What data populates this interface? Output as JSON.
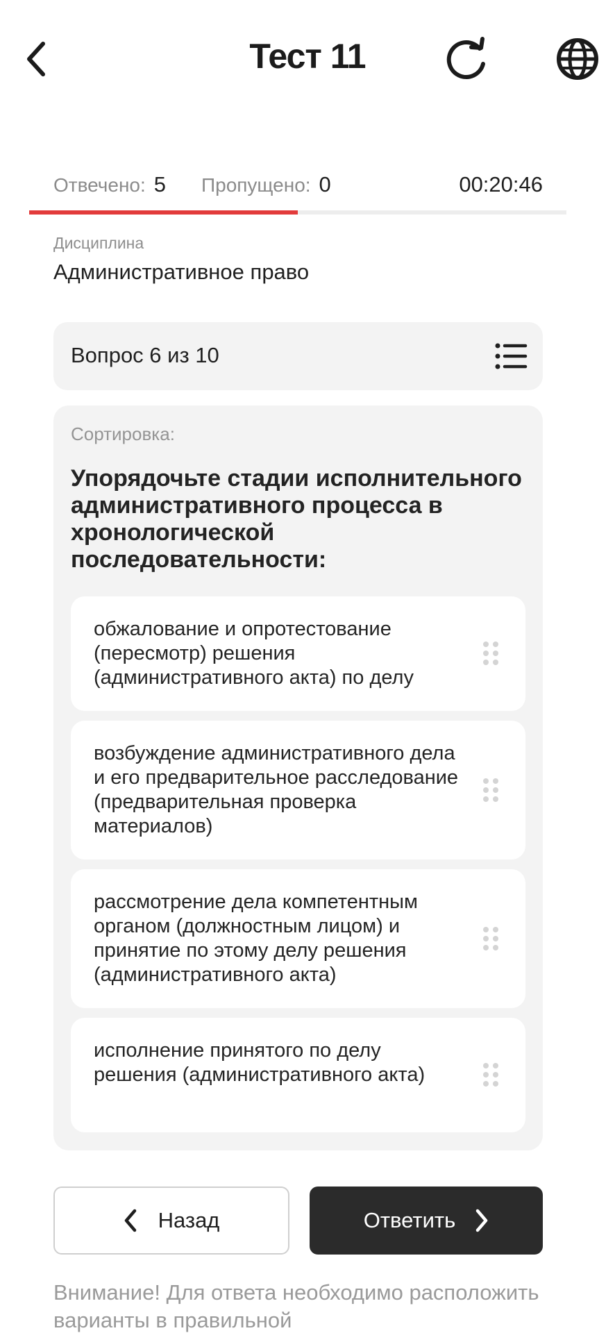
{
  "header": {
    "title": "Тест 11",
    "back_icon": "chevron-left-icon",
    "refresh_icon": "refresh-icon",
    "language_icon": "globe-icon"
  },
  "stats": {
    "answered_label": "Отвечено:",
    "answered_value": "5",
    "skipped_label": "Пропущено:",
    "skipped_value": "0",
    "timer": "00:20:46",
    "progress_fraction": 0.5,
    "progress_color": "#e23b3b"
  },
  "discipline": {
    "label": "Дисциплина",
    "value": "Административное право"
  },
  "question": {
    "counter": "Вопрос 6 из 10",
    "list_icon": "list-icon",
    "type_label": "Сортировка:",
    "text": "Упорядочьте стадии исполнительного административного процесса в хронологической последовательности:",
    "options": [
      {
        "text": "обжалование и опротестование (пересмотр) решения (административного акта) по делу"
      },
      {
        "text": "возбуждение административного дела и его предварительное расследование (предварительная проверка материалов)"
      },
      {
        "text": "рассмотрение дела компетентным органом (должностным лицом) и принятие по этому делу решения (административного акта)"
      },
      {
        "text": "исполнение принятого по делу решения (административного акта)"
      }
    ]
  },
  "actions": {
    "back_label": "Назад",
    "answer_label": "Ответить"
  },
  "notice": "Внимание! Для ответа необходимо расположить варианты в правильной",
  "colors": {
    "accent": "#e23b3b",
    "primary_button": "#2b2b2b",
    "card_bg": "#f3f3f3"
  }
}
